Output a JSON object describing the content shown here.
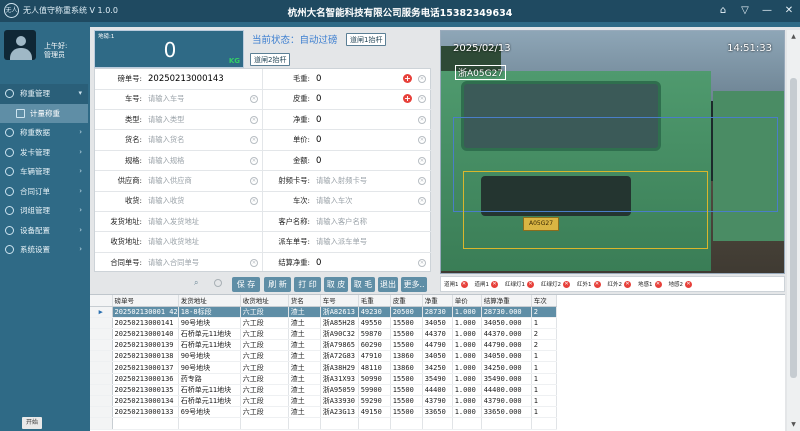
{
  "titlebar": {
    "logo": "无人",
    "app_title": "无人值守称重系统 V 1.0.0",
    "company": "杭州大名智能科技有限公司服务电话15382349634",
    "controls": [
      "⌂",
      "▽",
      "—",
      "✕"
    ]
  },
  "sidebar": {
    "greeting": "上午好:",
    "username": "管理员",
    "items": [
      {
        "label": "称重管理",
        "chevron": "▾"
      },
      {
        "label": "计量称重",
        "chevron": ""
      },
      {
        "label": "称重数据",
        "chevron": "›"
      },
      {
        "label": "发卡管理",
        "chevron": "›"
      },
      {
        "label": "车辆管理",
        "chevron": "›"
      },
      {
        "label": "合同订单",
        "chevron": "›"
      },
      {
        "label": "词组管理",
        "chevron": "›"
      },
      {
        "label": "设备配置",
        "chevron": "›"
      },
      {
        "label": "系统设置",
        "chevron": "›"
      }
    ],
    "start_label": "开始"
  },
  "weight": {
    "label": "地磅:1",
    "value": "0",
    "unit": "KG"
  },
  "status": {
    "text": "当前状态：自动过磅",
    "lift_gate_1": "道闸1抬杆",
    "lift_gate_2": "道闸2抬杆"
  },
  "form": {
    "order_no": {
      "label": "磅单号:",
      "value": "20250213000143"
    },
    "gross": {
      "label": "毛重:",
      "value": "0"
    },
    "plate": {
      "label": "车号:",
      "placeholder": "请输入车号"
    },
    "tare": {
      "label": "皮重:",
      "value": "0"
    },
    "type": {
      "label": "类型:",
      "placeholder": "请输入类型"
    },
    "net": {
      "label": "净重:",
      "value": "0"
    },
    "goods": {
      "label": "货名:",
      "placeholder": "请输入货名"
    },
    "unit_price": {
      "label": "单价:",
      "value": "0"
    },
    "spec": {
      "label": "规格:",
      "placeholder": "请输入规格"
    },
    "amount": {
      "label": "金额:",
      "value": "0"
    },
    "supplier": {
      "label": "供应商:",
      "placeholder": "请输入供应商"
    },
    "rfid": {
      "label": "射频卡号:",
      "placeholder": "请输入射频卡号"
    },
    "receiver": {
      "label": "收货:",
      "placeholder": "请输入收货"
    },
    "trips": {
      "label": "车次:",
      "placeholder": "请输入车次"
    },
    "ship_addr": {
      "label": "发货地址:",
      "placeholder": "请输入发货地址"
    },
    "customer": {
      "label": "客户名称:",
      "placeholder": "请输入客户名称"
    },
    "recv_addr": {
      "label": "收货地址:",
      "placeholder": "请输入收货地址"
    },
    "dispatch_no": {
      "label": "派车单号:",
      "placeholder": "请输入派车单号"
    },
    "contract_no": {
      "label": "合同单号:",
      "placeholder": "请输入合同单号"
    },
    "settle_net": {
      "label": "结算净重:",
      "value": "0"
    }
  },
  "actions": {
    "search_icon": "search-icon",
    "save": "保 存",
    "refresh": "刷 新",
    "print": "打 印",
    "take_tare": "取 皮",
    "take_gross": "取 毛",
    "exit": "退出",
    "more": "更多.."
  },
  "camera": {
    "date": "2025/02/13",
    "time": "14:51:33",
    "plate_overlay": "浙A05G27",
    "plate_text": "A05G27"
  },
  "sensors": [
    {
      "label": "道闸1"
    },
    {
      "label": "道闸1"
    },
    {
      "label": "红绿灯1"
    },
    {
      "label": "红绿灯2"
    },
    {
      "label": "红外1"
    },
    {
      "label": "红外2"
    },
    {
      "label": "地感1"
    },
    {
      "label": "地感2"
    }
  ],
  "table": {
    "headers": [
      "磅单号",
      "发货地址",
      "收货地址",
      "货名",
      "车号",
      "毛重",
      "皮重",
      "净重",
      "单价",
      "结算净重",
      "车次"
    ],
    "rows": [
      [
        "202502130001 42",
        "18-8标段",
        "六工段",
        "渣土",
        "浙A82613",
        "49230",
        "20500",
        "28730",
        "1.000",
        "28730.000",
        "2"
      ],
      [
        "20250213000141",
        "90号地块",
        "六工段",
        "渣土",
        "浙A85H28",
        "49550",
        "15500",
        "34050",
        "1.000",
        "34050.000",
        "1"
      ],
      [
        "20250213000140",
        "石桥单元11地块",
        "六工段",
        "渣土",
        "浙A90C32",
        "59870",
        "15500",
        "44370",
        "1.000",
        "44370.000",
        "2"
      ],
      [
        "20250213000139",
        "石桥单元11地块",
        "六工段",
        "渣土",
        "浙A79865",
        "60290",
        "15500",
        "44790",
        "1.000",
        "44790.000",
        "2"
      ],
      [
        "20250213000138",
        "90号地块",
        "六工段",
        "渣土",
        "浙A72G83",
        "47910",
        "13860",
        "34050",
        "1.000",
        "34050.000",
        "1"
      ],
      [
        "20250213000137",
        "90号地块",
        "六工段",
        "渣土",
        "浙A38H29",
        "48110",
        "13860",
        "34250",
        "1.000",
        "34250.000",
        "1"
      ],
      [
        "20250213000136",
        "药专路",
        "六工段",
        "渣土",
        "浙A31X93",
        "50990",
        "15500",
        "35490",
        "1.000",
        "35490.000",
        "1"
      ],
      [
        "20250213000135",
        "石桥单元11地块",
        "六工段",
        "渣土",
        "浙A95059",
        "59900",
        "15500",
        "44400",
        "1.000",
        "44400.000",
        "1"
      ],
      [
        "20250213000134",
        "石桥单元11地块",
        "六工段",
        "渣土",
        "浙A33930",
        "59290",
        "15500",
        "43790",
        "1.000",
        "43790.000",
        "1"
      ],
      [
        "20250213000133",
        "69号地块",
        "六工段",
        "渣土",
        "浙A23G13",
        "49150",
        "15500",
        "33650",
        "1.000",
        "33650.000",
        "1"
      ],
      [
        "",
        "",
        "",
        "",
        "",
        "",
        "",
        "",
        "",
        "",
        ""
      ]
    ]
  },
  "colors": {
    "accent": "#2f6a86",
    "danger": "#e7403a",
    "kg_green": "#34d065",
    "link_blue": "#3d7fd0"
  }
}
